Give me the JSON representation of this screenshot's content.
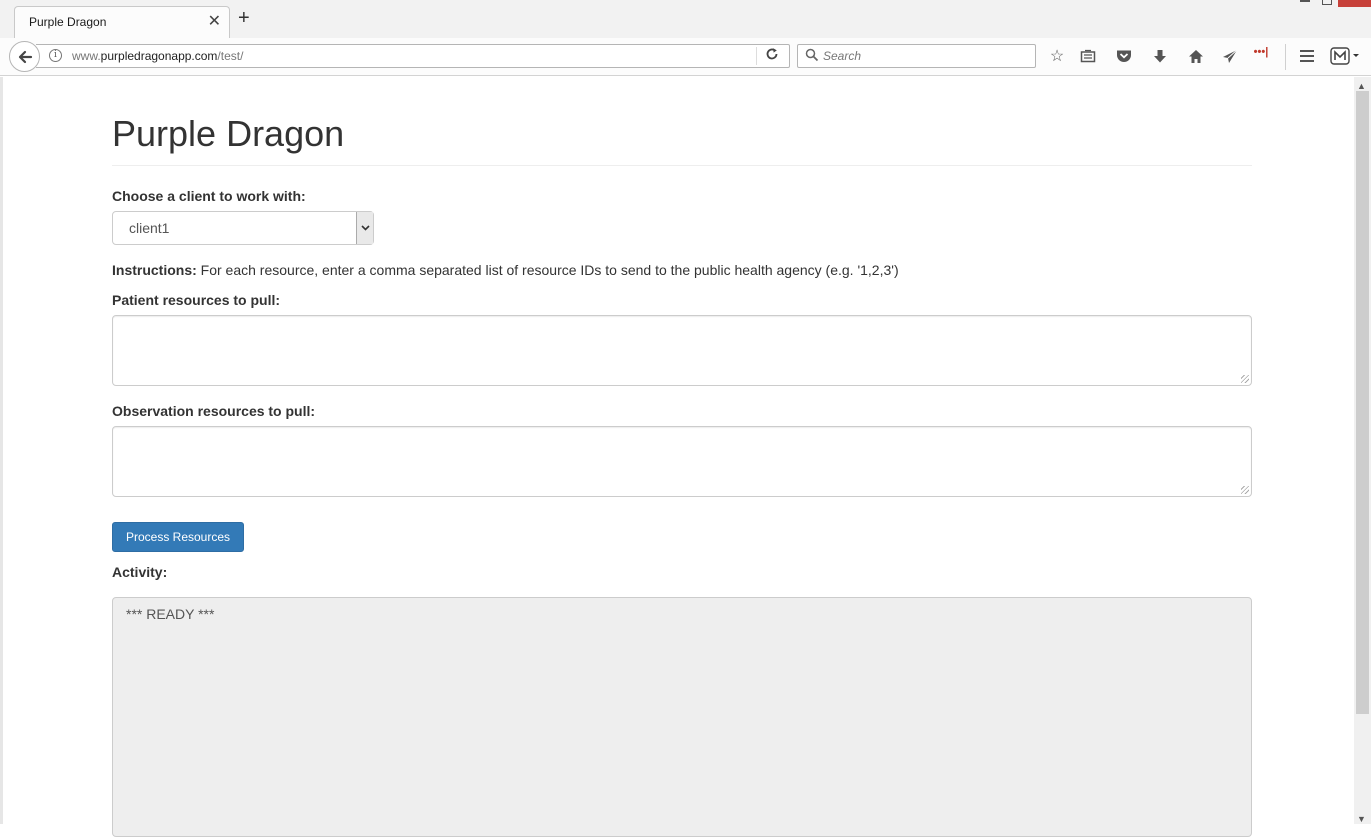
{
  "browser": {
    "tab_title": "Purple Dragon",
    "url_prefix": "www.",
    "url_domain": "purpledragonapp.com",
    "url_path": "/test/",
    "search_placeholder": "Search",
    "close_color": "#c7413a"
  },
  "page": {
    "title": "Purple Dragon",
    "client_label": "Choose a client to work with:",
    "client_selected": "client1",
    "instructions_label": "Instructions:",
    "instructions_text": " For each resource, enter a comma separated list of resource IDs to send to the public health agency (e.g. '1,2,3')",
    "patient_label": "Patient resources to pull:",
    "patient_value": "",
    "observation_label": "Observation resources to pull:",
    "observation_value": "",
    "process_button": "Process Resources",
    "activity_label": "Activity:",
    "activity_text": "*** READY ***",
    "accent_color": "#337ab7"
  },
  "icons": [
    "back-arrow-icon",
    "info-icon",
    "reload-icon",
    "search-icon",
    "star-icon",
    "reading-list-icon",
    "pocket-icon",
    "download-icon",
    "home-icon",
    "send-icon",
    "menu-icon",
    "extension-icon"
  ]
}
